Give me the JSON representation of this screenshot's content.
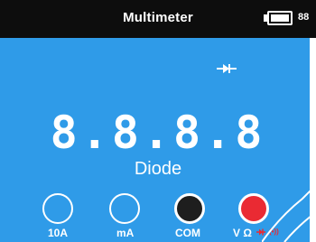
{
  "app": {
    "title": "Multimeter",
    "battery_level": "88"
  },
  "display": {
    "reading": "8.8.8.8",
    "mode": "Diode",
    "mode_icon": "diode-icon"
  },
  "jacks": {
    "j10a": {
      "label": "10A"
    },
    "ma": {
      "label": "mA"
    },
    "com": {
      "label": "COM"
    },
    "vohm": {
      "label": "V Ω",
      "extra_icons": [
        "diode-icon",
        "buzzer-icon"
      ],
      "extra_text": "(•))"
    }
  },
  "colors": {
    "background": "#2f9be8",
    "title_bar": "#0d0d0d",
    "accent_red": "#ea2a33",
    "com_jack": "#1e1e1e"
  }
}
